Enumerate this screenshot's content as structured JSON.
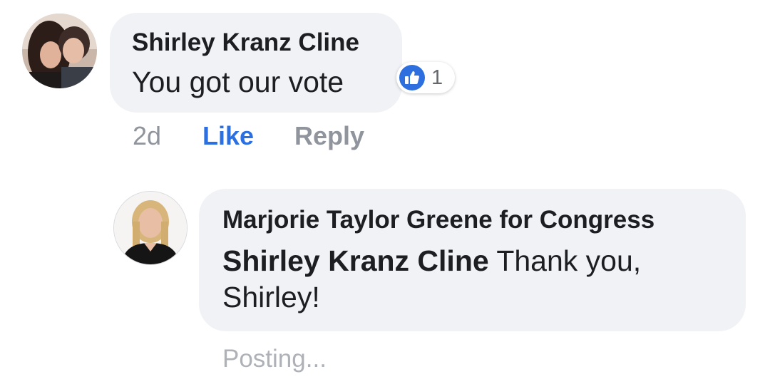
{
  "comments": [
    {
      "author": "Shirley Kranz Cline",
      "text": "You got our vote",
      "reaction_count": "1",
      "reaction_icon": "thumbs-up-icon",
      "time": "2d",
      "like_label": "Like",
      "reply_label": "Reply"
    }
  ],
  "reply": {
    "author": "Marjorie Taylor Greene for Congress",
    "mention": "Shirley Kranz Cline",
    "text": "Thank you, Shirley!",
    "status": "Posting..."
  },
  "colors": {
    "bubble": "#f0f2f5",
    "like_blue": "#2b6fe0",
    "muted_text": "#90949c"
  }
}
